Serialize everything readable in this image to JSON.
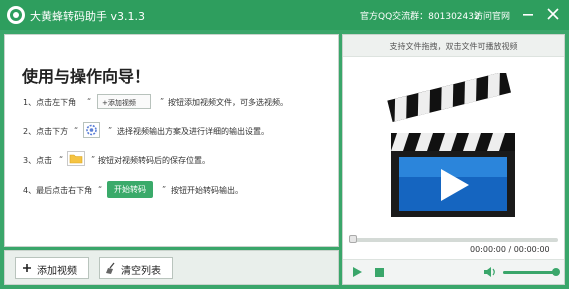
{
  "app": {
    "title": "大黄蜂转码助手 v3.1.3",
    "qq_group": "官方QQ交流群：801302432",
    "website_link": "访问官网"
  },
  "guide": {
    "title": "使用与操作向导！",
    "step1": {
      "prefix": "1、点击左下角",
      "button_label": "+添加视频",
      "suffix": "按钮添加视频文件，可多选视频。"
    },
    "step2": {
      "prefix": "2、点击下方",
      "icon": "settings-gear-icon",
      "suffix": "选择视频输出方案及进行详细的输出设置。"
    },
    "step3": {
      "prefix": "3、点击",
      "icon": "folder-icon",
      "suffix": "按钮对视频转码后的保存位置。"
    },
    "step4": {
      "prefix": "4、最后点击右下角",
      "button_label": "开始转码",
      "suffix": "按钮开始转码输出。"
    },
    "quote_open": "“",
    "quote_close": "”"
  },
  "toolbar": {
    "add_video_label": "添加视频",
    "clear_list_label": "清空列表"
  },
  "player": {
    "hint": "支持文件拖拽，双击文件可播放视频",
    "time": "00:00:00 / 00:00:00",
    "progress": 0.0,
    "volume": 0.95
  },
  "colors": {
    "accent": "#3aa66a",
    "titlebar": "#2e9e5e"
  }
}
